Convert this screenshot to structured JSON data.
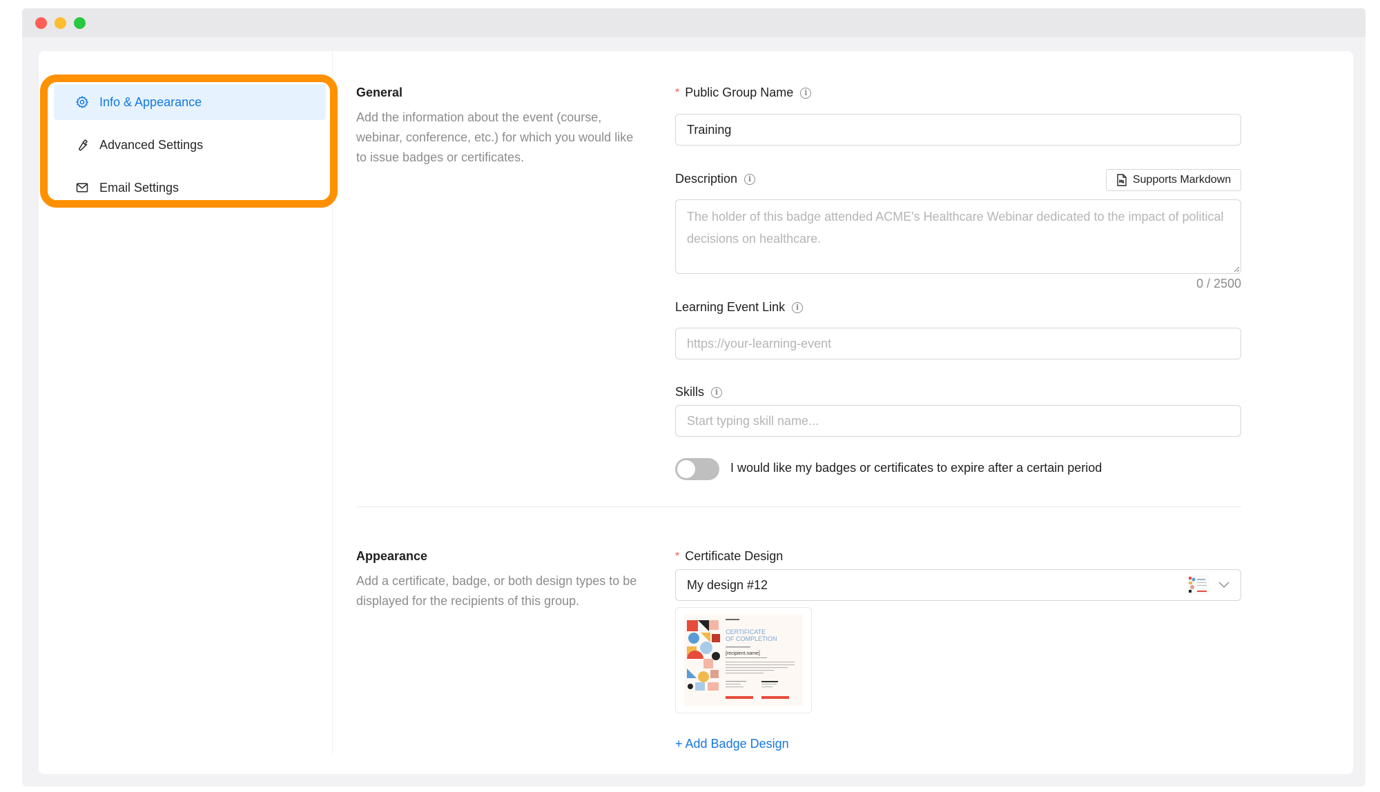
{
  "sidebar": {
    "items": [
      {
        "label": "Info & Appearance",
        "icon": "gear-icon",
        "active": true
      },
      {
        "label": "Advanced Settings",
        "icon": "wrench-icon",
        "active": false
      },
      {
        "label": "Email Settings",
        "icon": "mail-icon",
        "active": false
      }
    ]
  },
  "general": {
    "title": "General",
    "description": "Add the information about the event (course, webinar, conference, etc.) for which you would like to issue badges or certificates."
  },
  "form": {
    "group_name": {
      "label": "Public Group Name",
      "value": "Training"
    },
    "description": {
      "label": "Description",
      "markdown_button": "Supports Markdown",
      "placeholder": "The holder of this badge attended ACME's Healthcare Webinar dedicated to the impact of political decisions on healthcare.",
      "counter": "0 / 2500"
    },
    "event_link": {
      "label": "Learning Event Link",
      "placeholder": "https://your-learning-event"
    },
    "skills": {
      "label": "Skills",
      "placeholder": "Start typing skill name..."
    },
    "expire_toggle": {
      "label": "I would like my badges or certificates to expire after a certain period",
      "on": false
    }
  },
  "appearance": {
    "title": "Appearance",
    "description": "Add a certificate, badge, or both design types to be displayed for the recipients of this group.",
    "certificate_design": {
      "label": "Certificate Design",
      "value": "My design #12"
    },
    "preview": {
      "title_line1": "CERTIFICATE",
      "title_line2": "OF COMPLETION",
      "recipient": "[recipient.name]"
    },
    "add_badge": "+ Add Badge Design"
  },
  "colors": {
    "accent": "#1677e0",
    "highlight": "#ff9000",
    "required": "#ff4d4f"
  }
}
